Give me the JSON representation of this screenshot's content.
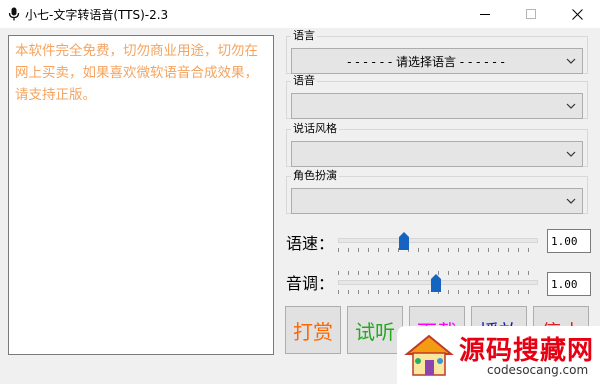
{
  "window": {
    "title": "小七-文字转语音(TTS)-2.3",
    "controls": {
      "minimize_icon": "minimize-icon",
      "maximize_icon": "maximize-icon",
      "close_icon": "close-icon"
    }
  },
  "notice_text": "本软件完全免费，切勿商业用途，切勿在网上买卖，如果喜欢微软语音合成效果，请支持正版。",
  "groups": [
    {
      "label": "语言",
      "value": "- - - - - - 请选择语言 - - - - - -"
    },
    {
      "label": "语音",
      "value": ""
    },
    {
      "label": "说话风格",
      "value": ""
    },
    {
      "label": "角色扮演",
      "value": ""
    }
  ],
  "sliders": {
    "speed": {
      "label": "语速：",
      "value": "1.00",
      "position_fraction": 0.33
    },
    "pitch": {
      "label": "音调：",
      "value": "1.00",
      "position_fraction": 0.49
    }
  },
  "buttons": [
    {
      "label": "打赏",
      "color": "#ff6600"
    },
    {
      "label": "试听",
      "color": "#22aa22"
    },
    {
      "label": "下载",
      "color": "#ff00ff"
    },
    {
      "label": "播放",
      "color": "#1a1aaa"
    },
    {
      "label": "停止",
      "color": "#dd2222"
    }
  ],
  "watermark": {
    "logo": "源码搜藏网",
    "domain": "codesocang.com"
  },
  "colors": {
    "notice_text": "#f4a460",
    "slider_thumb": "#1565c0",
    "watermark_red": "#e60012"
  }
}
